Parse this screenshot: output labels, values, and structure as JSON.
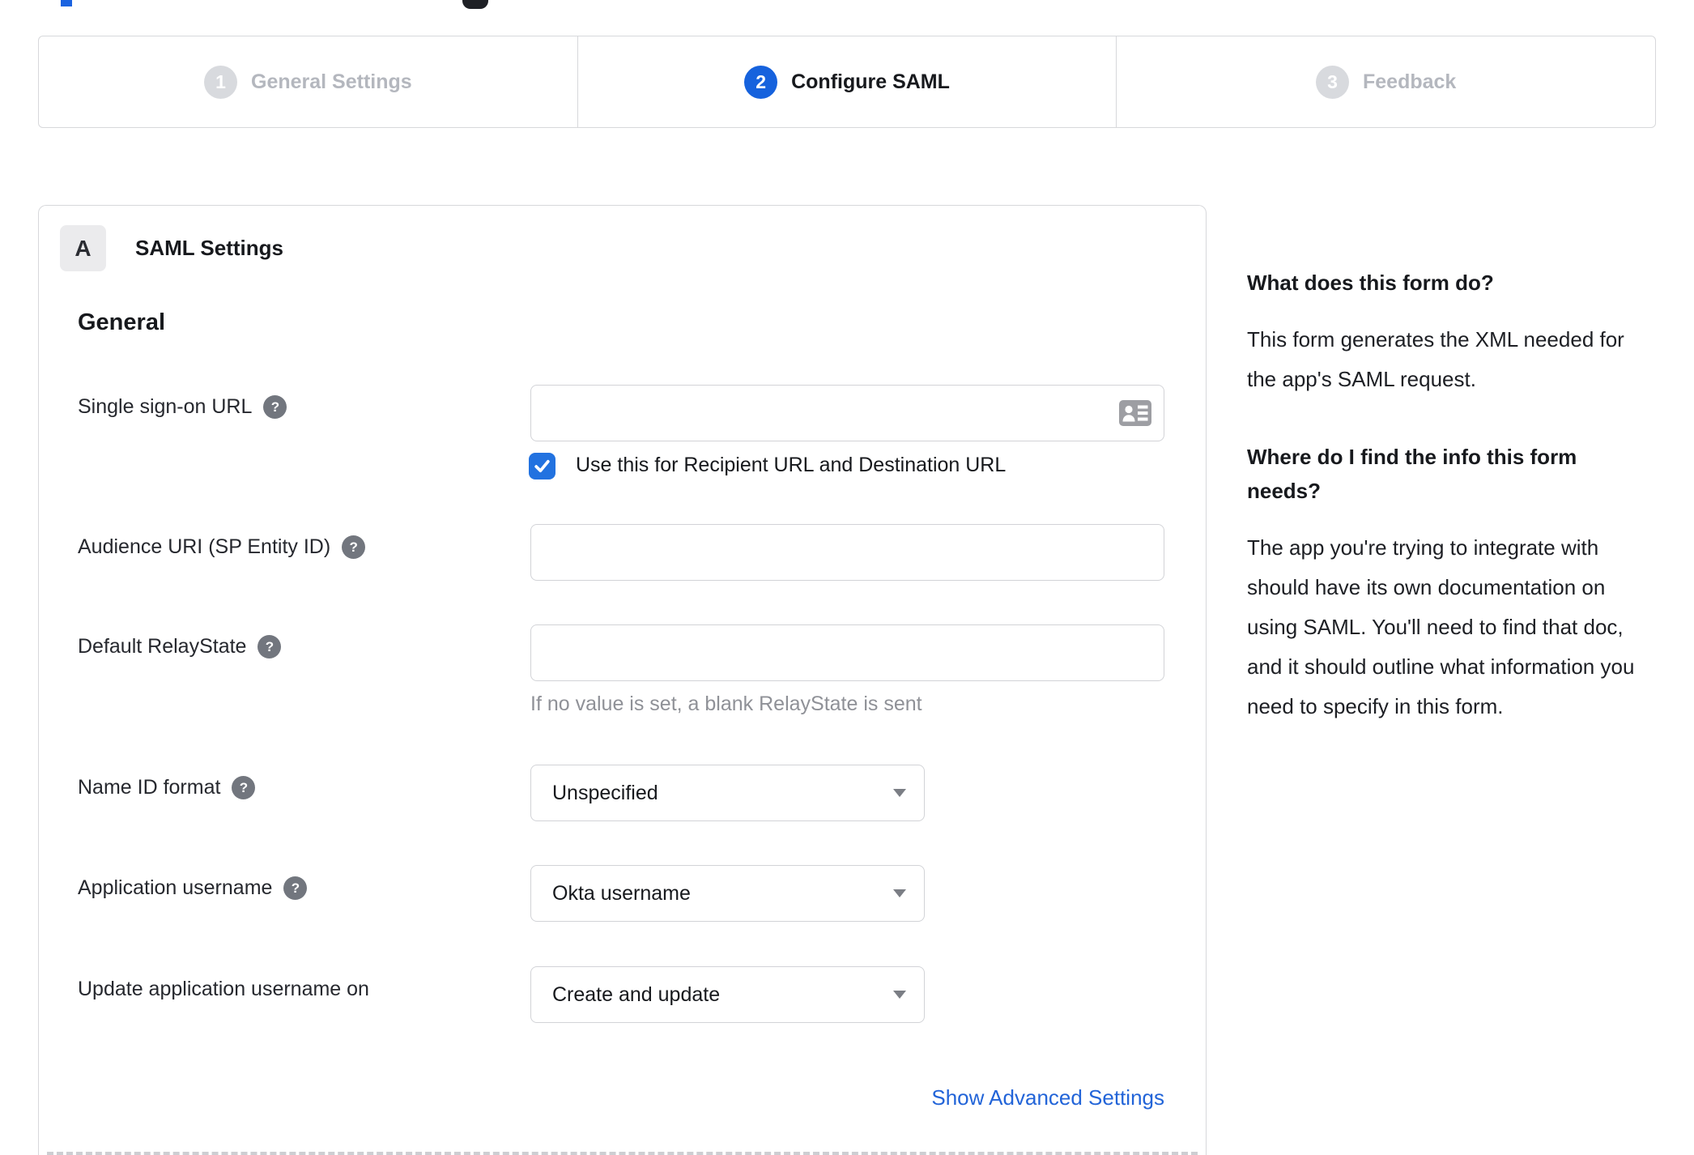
{
  "colors": {
    "accent_blue": "#1662dd",
    "checkbox_blue": "#2272e0",
    "link_blue": "#2264d8",
    "inactive_gray": "#b4b7be",
    "border_gray": "#d7d8db"
  },
  "stepper": {
    "steps": [
      {
        "number": "1",
        "label": "General Settings",
        "state": "inactive"
      },
      {
        "number": "2",
        "label": "Configure SAML",
        "state": "active"
      },
      {
        "number": "3",
        "label": "Feedback",
        "state": "inactive"
      }
    ]
  },
  "form": {
    "section_badge": "A",
    "section_title": "SAML Settings",
    "group_heading": "General",
    "help_glyph": "?",
    "fields": {
      "sso_url": {
        "label": "Single sign-on URL",
        "value": ""
      },
      "sso_checkbox": {
        "label": "Use this for Recipient URL and Destination URL",
        "checked": true
      },
      "audience_uri": {
        "label": "Audience URI (SP Entity ID)",
        "value": ""
      },
      "relay_state": {
        "label": "Default RelayState",
        "value": "",
        "hint": "If no value is set, a blank RelayState is sent"
      },
      "name_id_format": {
        "label": "Name ID format",
        "value": "Unspecified"
      },
      "app_username": {
        "label": "Application username",
        "value": "Okta username"
      },
      "update_app_username": {
        "label": "Update application username on",
        "value": "Create and update"
      }
    },
    "advanced_link": "Show Advanced Settings"
  },
  "sidebar": {
    "section1": {
      "heading": "What does this form do?",
      "body": "This form generates the XML needed for the app's SAML request."
    },
    "section2": {
      "heading": "Where do I find the info this form needs?",
      "body": "The app you're trying to integrate with should have its own documentation on using SAML. You'll need to find that doc, and it should outline what information you need to specify in this form."
    }
  }
}
